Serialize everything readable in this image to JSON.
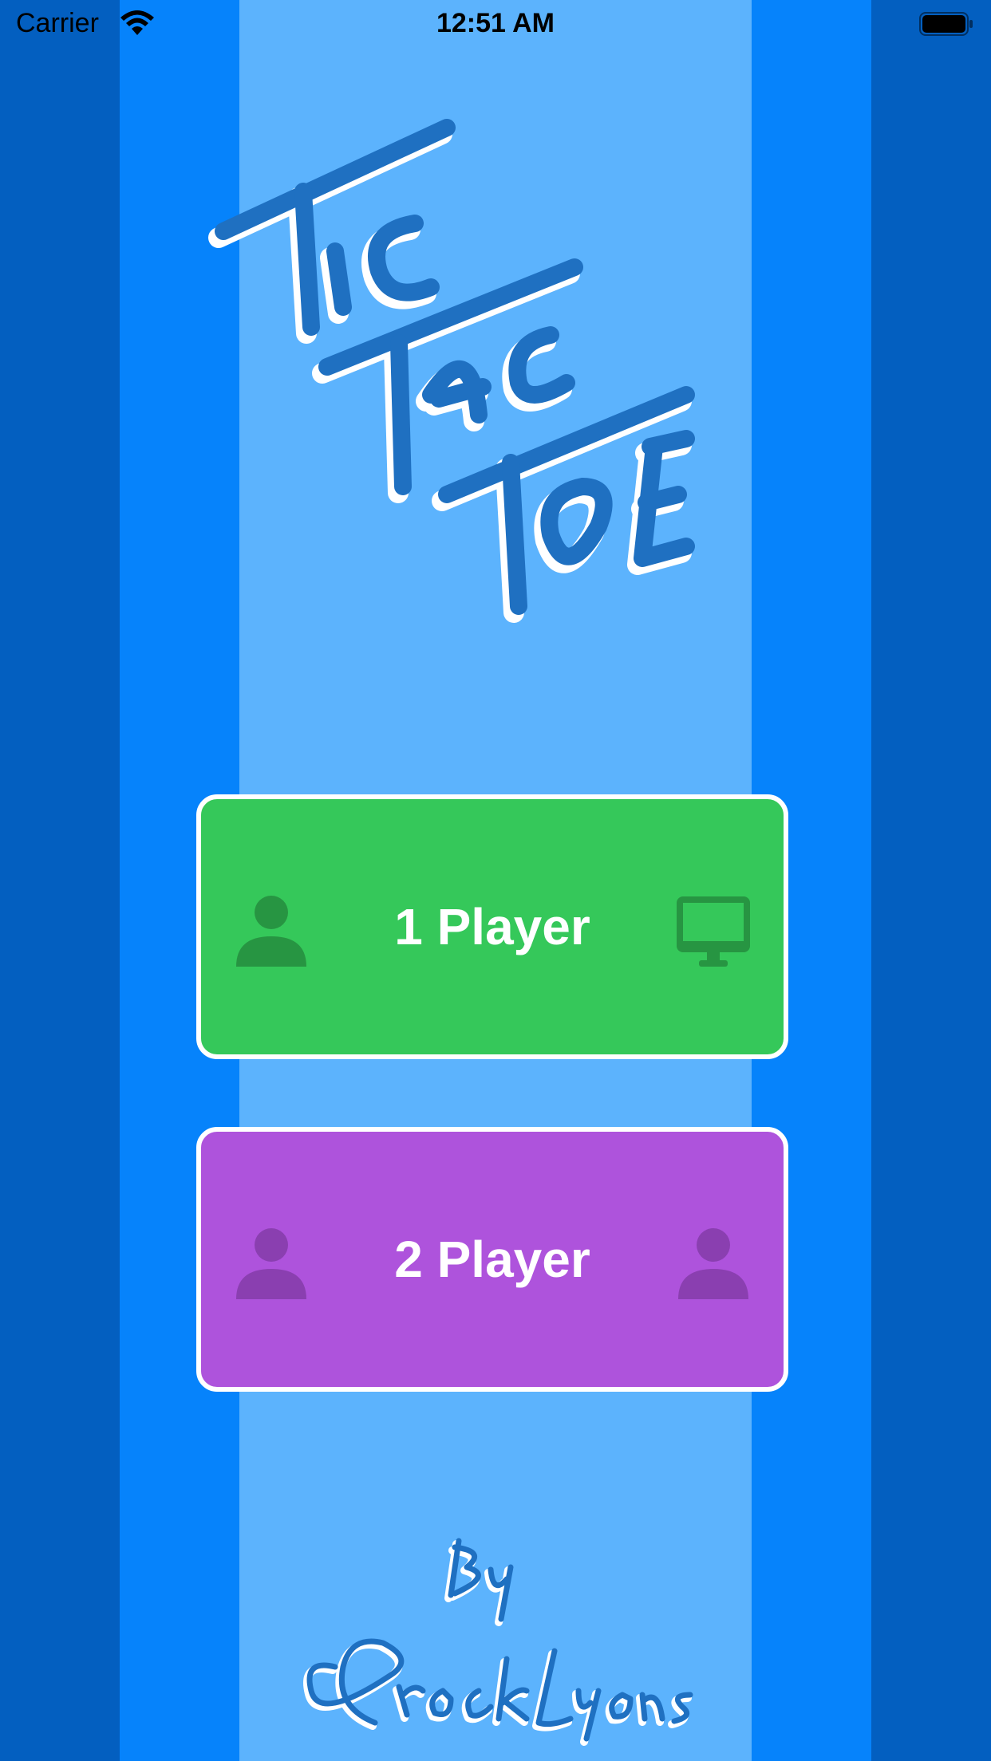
{
  "status_bar": {
    "carrier": "Carrier",
    "time": "12:51 AM",
    "wifi_icon": "wifi-icon",
    "battery_icon": "battery-icon"
  },
  "title_art": "Tic Tac Toe",
  "buttons": {
    "one_player": {
      "label": "1 Player",
      "left_icon": "person-icon",
      "right_icon": "desktop-computer-icon",
      "color": "#35c85a"
    },
    "two_player": {
      "label": "2 Player",
      "left_icon": "person-icon",
      "right_icon": "person-icon",
      "color": "#ae53dc"
    }
  },
  "credit_signature": "By Brock Lyons",
  "colors": {
    "outer_stripe": "#035fc0",
    "middle_stripe": "#0683fb",
    "center_stripe": "#5cb3fd",
    "ink": "#1f70c1"
  }
}
